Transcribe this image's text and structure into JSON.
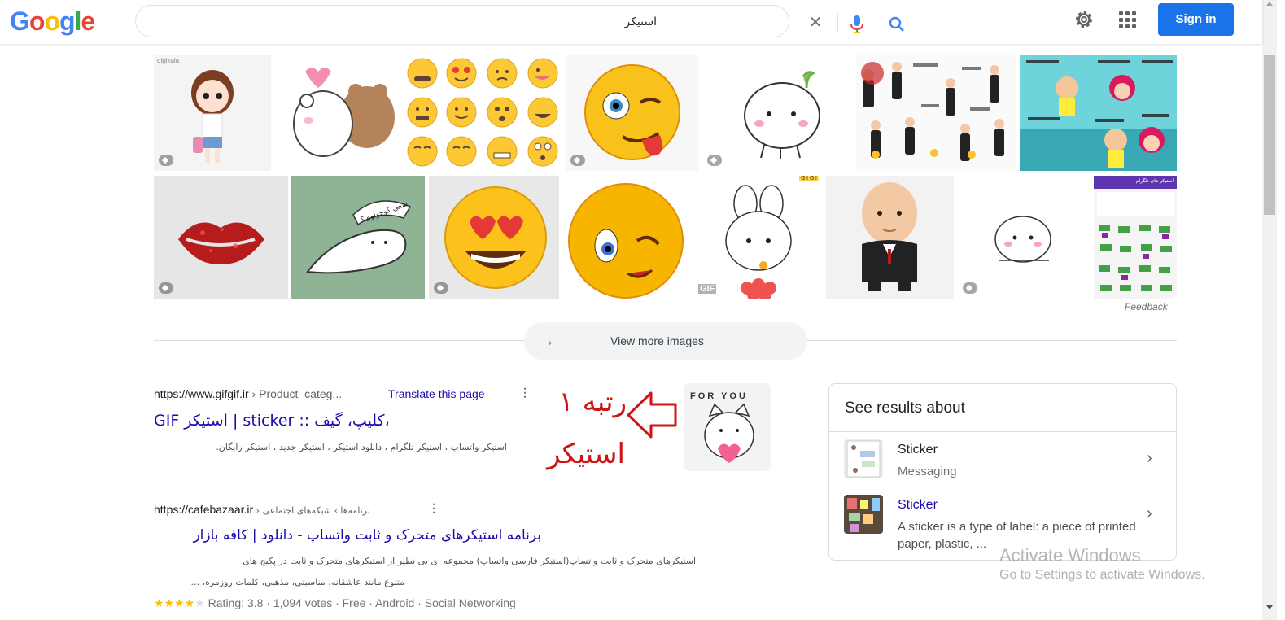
{
  "header": {
    "logo_letters": [
      "G",
      "o",
      "o",
      "g",
      "l",
      "e"
    ],
    "search_value": "استیکر",
    "signin_label": "Sign in"
  },
  "images": {
    "feedback_label": "Feedback",
    "view_more_label": "View more images",
    "view_more_arrow": "→",
    "tile1_brand": "digikala",
    "tile10_label": "سعی کوچولوی؟",
    "tile12_badge": "GIF",
    "tile12_corner": "Gif Gif",
    "tile14_header": "استیکر های تلگرام"
  },
  "annotation": {
    "line1": "رتبه ۱",
    "line2": "استیکر",
    "color": "#d01313"
  },
  "results": [
    {
      "cite_host": "https://www.gifgif.ir",
      "cite_path": " › Product_categ...",
      "translate_label": "Translate this page",
      "title": "GIF استیکر | sticker :: کلیپ، گیف،",
      "snippet": "استیکر واتساپ ، استیکر تلگرام ، دانلود استیکر ، استیکر جدید ، استیکر رایگان.",
      "thumb_text": "FOR YOU"
    },
    {
      "cite_host": "https://cafebazaar.ir",
      "cite_path": " › برنامه‌ها › شبکه‌های اجتماعی",
      "title": "برنامه استیکرهای متحرک و ثابت واتساپ - دانلود | کافه بازار",
      "snippet_line1": "استیکرهای متحرک و ثابت واتساپ(استیکر فارسی واتساپ) مجموعه ای بی نظیر از استیکرهای متحرک و ثابت در پکیج های",
      "snippet_line2": "متنوع مانند عاشقانه، مناسبتی، مذهبی، کلمات روزمره، ...",
      "stars_filled": "★★★★",
      "stars_empty": "★",
      "rating_text": "Rating: 3.8 · 1,094 votes · Free · Android · Social Networking"
    }
  ],
  "side_panel": {
    "title": "See results about",
    "items": [
      {
        "name": "Sticker",
        "desc": "Messaging",
        "name_color": "#202124"
      },
      {
        "name": "Sticker",
        "desc": "A sticker is a type of label: a piece of printed paper, plastic, ...",
        "name_color": "#1a0dab"
      }
    ]
  },
  "watermark": {
    "line1": "Activate Windows",
    "line2": "Go to Settings to activate Windows."
  }
}
